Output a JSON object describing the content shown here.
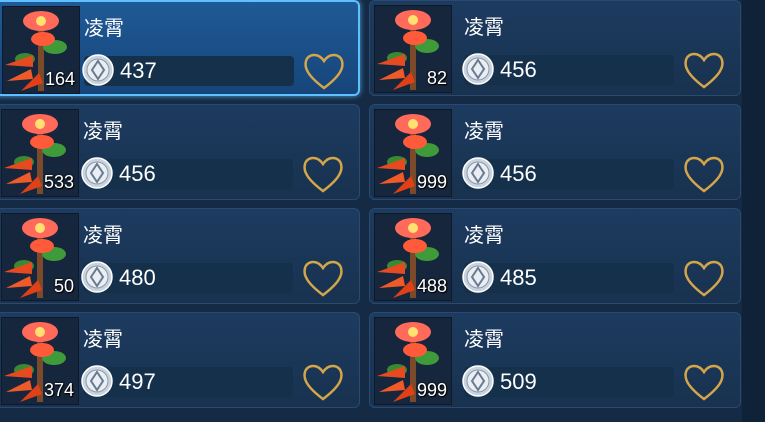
{
  "colors": {
    "accent": "#5fc0ff",
    "heart": "#d4a64a",
    "card": "#1a3556"
  },
  "items": [
    {
      "name": "凌霄",
      "qty": "164",
      "price": "437",
      "selected": true,
      "favorite_icon": "heart-outline-icon"
    },
    {
      "name": "凌霄",
      "qty": "82",
      "price": "456",
      "selected": false,
      "favorite_icon": "heart-outline-icon"
    },
    {
      "name": "凌霄",
      "qty": "533",
      "price": "456",
      "selected": false,
      "favorite_icon": "heart-outline-icon"
    },
    {
      "name": "凌霄",
      "qty": "999",
      "price": "456",
      "selected": false,
      "favorite_icon": "heart-outline-icon"
    },
    {
      "name": "凌霄",
      "qty": "50",
      "price": "480",
      "selected": false,
      "favorite_icon": "heart-outline-icon"
    },
    {
      "name": "凌霄",
      "qty": "488",
      "price": "485",
      "selected": false,
      "favorite_icon": "heart-outline-icon"
    },
    {
      "name": "凌霄",
      "qty": "374",
      "price": "497",
      "selected": false,
      "favorite_icon": "heart-outline-icon"
    },
    {
      "name": "凌霄",
      "qty": "999",
      "price": "509",
      "selected": false,
      "favorite_icon": "heart-outline-icon"
    }
  ]
}
